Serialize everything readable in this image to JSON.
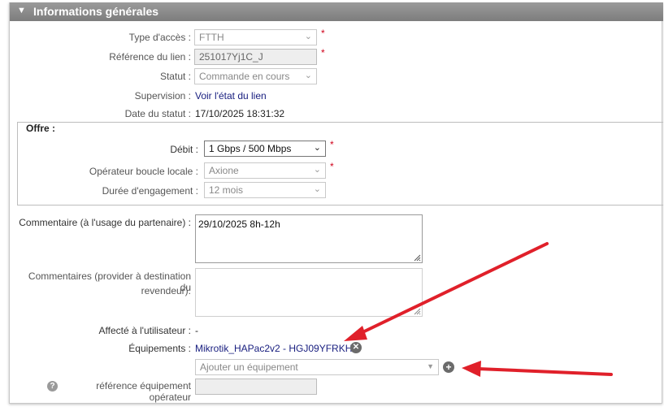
{
  "panel": {
    "title": "Informations générales"
  },
  "access_type": {
    "label": "Type d'accès :",
    "value": "FTTH"
  },
  "link_ref": {
    "label": "Référence du lien :",
    "value": "251017Yj1C_J"
  },
  "status": {
    "label": "Statut :",
    "value": "Commande en cours"
  },
  "supervision": {
    "label": "Supervision :",
    "link": "Voir l'état du lien"
  },
  "status_date": {
    "label": "Date du statut :",
    "value": "17/10/2025 18:31:32"
  },
  "offre": {
    "legend": "Offre :",
    "debit": {
      "label": "Débit :",
      "value": "1 Gbps / 500 Mbps"
    },
    "operator": {
      "label": "Opérateur boucle locale :",
      "value": "Axione"
    },
    "duration": {
      "label": "Durée d'engagement :",
      "value": "12 mois"
    }
  },
  "comment_partner": {
    "label": "Commentaire (à l'usage du partenaire) :",
    "value": "29/10/2025 8h-12h"
  },
  "comment_provider": {
    "label_1": "Commentaires (provider à destination du",
    "label_2": "revendeur):",
    "value": ""
  },
  "assigned_user": {
    "label": "Affecté à l'utilisateur :",
    "value": "-"
  },
  "equipments": {
    "label": "Équipements :",
    "item": "Mikrotik_HAPac2v2 - HGJ09YFRKHH",
    "add_placeholder": "Ajouter un équipement"
  },
  "operator_ref": {
    "label": "référence équipement opérateur",
    "value": ""
  },
  "required_mark": "*",
  "icons": {
    "collapse": "triangle-down-icon",
    "remove": "close-circle-icon",
    "add": "plus-circle-icon",
    "help": "question-circle-icon"
  },
  "colors": {
    "header": "#8a8a8a",
    "link": "#1a2080",
    "required": "#d0021b",
    "annotation": "#e0202a"
  }
}
